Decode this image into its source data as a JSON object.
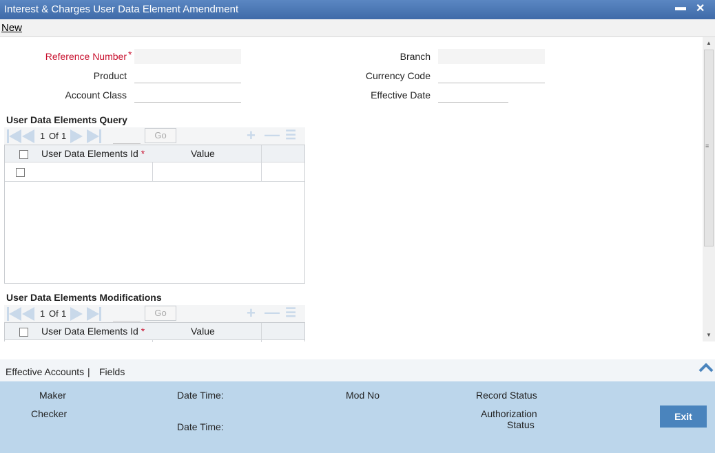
{
  "window": {
    "title": "Interest & Charges User Data Element Amendment",
    "minimize": "▬",
    "close": "✕"
  },
  "menu": {
    "new": "New"
  },
  "form": {
    "reference_number": "Reference Number",
    "required_mark": "*",
    "product": "Product",
    "account_class": "Account Class",
    "branch": "Branch",
    "currency_code": "Currency Code",
    "effective_date": "Effective Date"
  },
  "query": {
    "title": "User Data Elements Query",
    "page_current": "1",
    "page_of": "Of",
    "page_total": "1",
    "go": "Go",
    "col_id": "User Data Elements Id",
    "col_value": "Value"
  },
  "mods": {
    "title": "User Data Elements Modifications",
    "page_current": "1",
    "page_of": "Of",
    "page_total": "1",
    "go": "Go",
    "col_id": "User Data Elements Id",
    "col_value": "Value"
  },
  "tabs": {
    "effective_accounts": "Effective Accounts",
    "sep": "|",
    "fields": "Fields"
  },
  "footer": {
    "maker": "Maker",
    "checker": "Checker",
    "date_time_1": "Date Time:",
    "date_time_2": "Date Time:",
    "mod_no": "Mod No",
    "record_status": "Record Status",
    "authorization": "Authorization",
    "status": "Status",
    "exit": "Exit"
  },
  "icons": {
    "first": "first-page-icon",
    "prev": "prev-page-icon",
    "next": "next-page-icon",
    "last": "last-page-icon",
    "add": "add-row-icon",
    "delete": "delete-row-icon",
    "view": "view-rows-icon",
    "collapse": "chevron-up-icon"
  },
  "colors": {
    "titlebar": "#4a77b5",
    "footer": "#bcd6eb",
    "exit": "#4a84bd",
    "required": "#c8102e"
  }
}
